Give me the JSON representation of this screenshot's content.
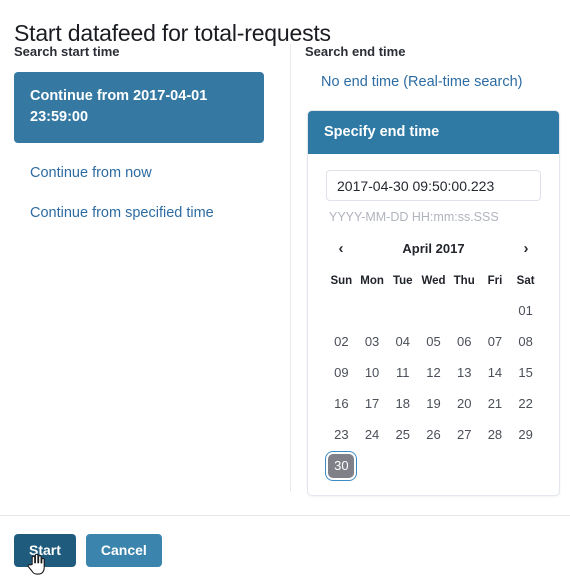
{
  "page": {
    "title": "Start datafeed for total-requests"
  },
  "start_time": {
    "heading": "Search start time",
    "options": [
      {
        "label": "Continue from 2017-04-01 23:59:00",
        "selected": true
      },
      {
        "label": "Continue from now",
        "selected": false
      },
      {
        "label": "Continue from specified time",
        "selected": false
      }
    ]
  },
  "end_time": {
    "heading": "Search end time",
    "no_end_label": "No end time (Real-time search)",
    "panel_title": "Specify end time",
    "input_value": "2017-04-30 09:50:00.223",
    "input_placeholder": "YYYY-MM-DD HH:mm:ss.SSS",
    "format_hint": "YYYY-MM-DD HH:mm:ss.SSS"
  },
  "calendar": {
    "month_label": "April 2017",
    "prev_icon": "chevron-left-icon",
    "next_icon": "chevron-right-icon",
    "prev_glyph": "‹",
    "next_glyph": "›",
    "weekdays": [
      "Sun",
      "Mon",
      "Tue",
      "Wed",
      "Thu",
      "Fri",
      "Sat"
    ],
    "leading_blanks": 6,
    "days": [
      "01",
      "02",
      "03",
      "04",
      "05",
      "06",
      "07",
      "08",
      "09",
      "10",
      "11",
      "12",
      "13",
      "14",
      "15",
      "16",
      "17",
      "18",
      "19",
      "20",
      "21",
      "22",
      "23",
      "24",
      "25",
      "26",
      "27",
      "28",
      "29",
      "30"
    ],
    "selected_day": "30"
  },
  "footer": {
    "start_label": "Start",
    "cancel_label": "Cancel"
  },
  "colors": {
    "accent_blue": "#3579a3",
    "panel_header_blue": "#2e7aa5",
    "link_blue": "#2d6ca2",
    "primary_button": "#1f5b7d",
    "secondary_button": "#3b84ad",
    "selected_day_bg": "#808089",
    "focus_ring": "#3d8bc4"
  },
  "cursor": {
    "icon": "pointing-hand-cursor"
  }
}
